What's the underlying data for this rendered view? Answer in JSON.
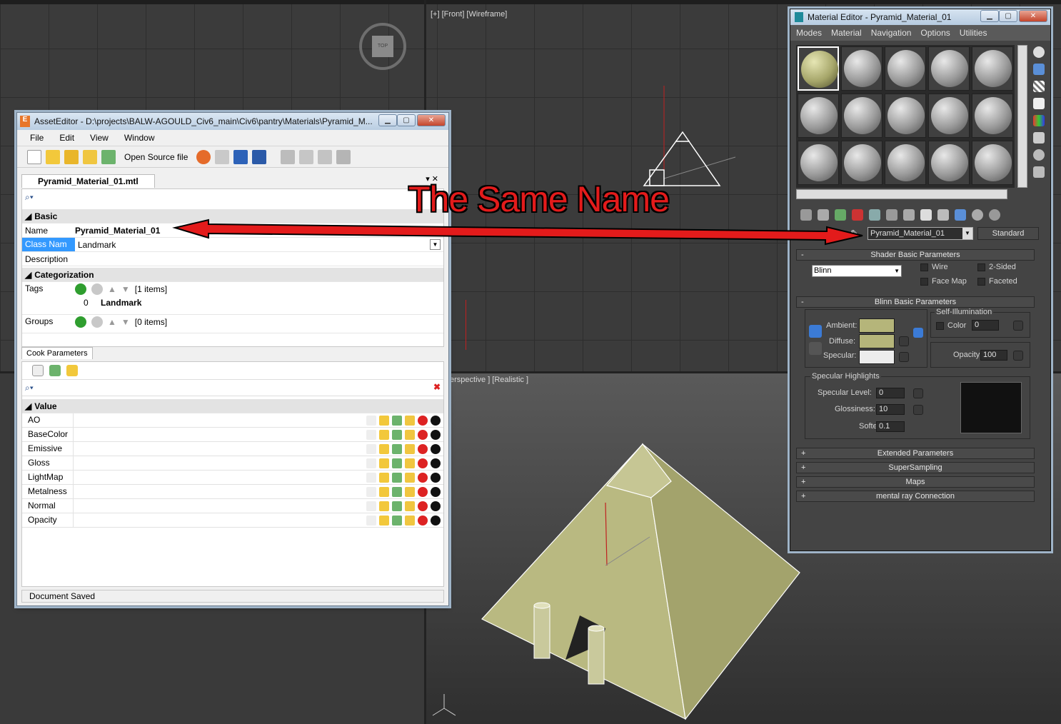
{
  "viewports": {
    "front_label": "[+] [Front] [Wireframe]",
    "perspective_label": "erspective ] [Realistic ]",
    "viewcube_label": "TOP"
  },
  "annotation": {
    "text": "The Same Name",
    "color": "#e31b1b"
  },
  "asset_editor": {
    "title": "AssetEditor - D:\\projects\\BALW-AGOULD_Civ6_main\\Civ6\\pantry\\Materials\\Pyramid_M...",
    "menu": [
      "File",
      "Edit",
      "View",
      "Window"
    ],
    "toolbar": {
      "open_source_label": "Open Source file"
    },
    "tab": "Pyramid_Material_01.mtl",
    "sections": {
      "basic": "Basic",
      "categorization": "Categorization",
      "value": "Value"
    },
    "fields": {
      "name_label": "Name",
      "name_value": "Pyramid_Material_01",
      "class_label": "Class Nam",
      "class_value": "Landmark",
      "description_label": "Description",
      "tags_label": "Tags",
      "tags_count": "[1 items]",
      "tag_index": "0",
      "tag_value": "Landmark",
      "groups_label": "Groups",
      "groups_count": "[0 items]"
    },
    "cook_tab": "Cook Parameters",
    "values": [
      "AO",
      "BaseColor",
      "Emissive",
      "Gloss",
      "LightMap",
      "Metalness",
      "Normal",
      "Opacity"
    ],
    "status": "Document Saved"
  },
  "material_editor": {
    "title": "Material Editor - Pyramid_Material_01",
    "menu": [
      "Modes",
      "Material",
      "Navigation",
      "Options",
      "Utilities"
    ],
    "material_name": "Pyramid_Material_01",
    "material_type": "Standard",
    "shader": {
      "rollout": "Shader Basic Parameters",
      "shader_value": "Blinn",
      "wire": "Wire",
      "two_sided": "2-Sided",
      "face_map": "Face Map",
      "faceted": "Faceted"
    },
    "blinn": {
      "rollout": "Blinn Basic Parameters",
      "ambient": "Ambient:",
      "diffuse": "Diffuse:",
      "specular": "Specular:",
      "self_illum": "Self-Illumination",
      "color": "Color",
      "color_value": "0",
      "opacity": "Opacity:",
      "opacity_value": "100",
      "ambient_color": "#b5b57a",
      "diffuse_color": "#b5b57a",
      "specular_color": "#ececec"
    },
    "highlights": {
      "title": "Specular Highlights",
      "level_label": "Specular Level:",
      "level_value": "0",
      "gloss_label": "Glossiness:",
      "gloss_value": "10",
      "soften_label": "Soften:",
      "soften_value": "0.1"
    },
    "rollouts": [
      "Extended Parameters",
      "SuperSampling",
      "Maps",
      "mental ray Connection"
    ]
  }
}
